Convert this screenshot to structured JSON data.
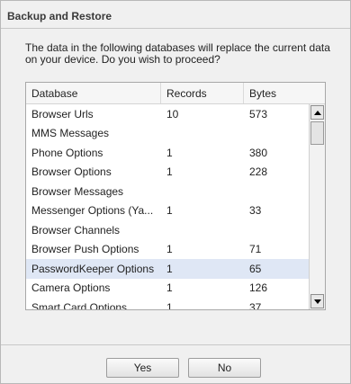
{
  "dialog": {
    "title": "Backup and Restore",
    "message": "The data in the following databases will replace the current data on your device. Do you wish to proceed?"
  },
  "table": {
    "columns": [
      "Database",
      "Records",
      "Bytes"
    ],
    "rows": [
      {
        "database": "Browser Urls",
        "records": "10",
        "bytes": "573"
      },
      {
        "database": "MMS Messages",
        "records": "",
        "bytes": ""
      },
      {
        "database": "Phone Options",
        "records": "1",
        "bytes": "380"
      },
      {
        "database": "Browser Options",
        "records": "1",
        "bytes": "228"
      },
      {
        "database": "Browser Messages",
        "records": "",
        "bytes": ""
      },
      {
        "database": "Messenger Options (Ya...",
        "records": "1",
        "bytes": "33"
      },
      {
        "database": "Browser Channels",
        "records": "",
        "bytes": ""
      },
      {
        "database": "Browser Push Options",
        "records": "1",
        "bytes": "71"
      },
      {
        "database": "PasswordKeeper Options",
        "records": "1",
        "bytes": "65",
        "selected": true
      },
      {
        "database": "Camera Options",
        "records": "1",
        "bytes": "126"
      },
      {
        "database": "Smart Card Options",
        "records": "1",
        "bytes": "37"
      }
    ]
  },
  "buttons": {
    "yes": "Yes",
    "no": "No"
  },
  "colors": {
    "selected_row": "#dfe7f5",
    "dialog_bg": "#f0f0f0"
  }
}
